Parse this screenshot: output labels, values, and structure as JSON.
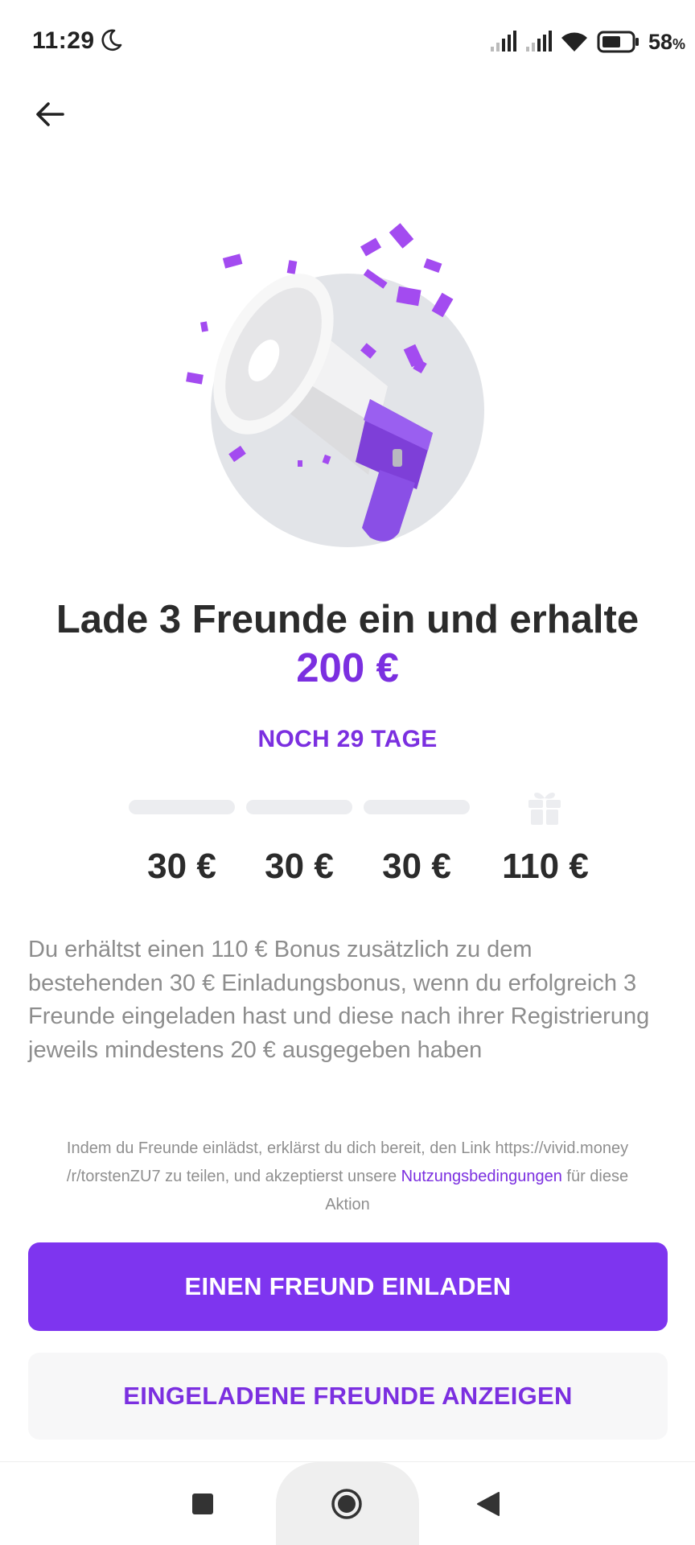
{
  "status_bar": {
    "time": "11:29",
    "battery_percent": "58",
    "battery_unit": "%",
    "icons": [
      "moon-icon",
      "signal-icon",
      "signal-icon",
      "wifi-icon",
      "battery-icon"
    ]
  },
  "header": {
    "back_icon": "arrow-left-icon"
  },
  "hero": {
    "image": "megaphone-confetti-illustration"
  },
  "main": {
    "headline": "Lade 3 Freunde ein und erhalte",
    "amount": "200 €",
    "countdown": "NOCH 29 TAGE",
    "progress": {
      "completed": 0,
      "total": 3
    },
    "rewards": [
      "30 €",
      "30 €",
      "30 €",
      "110 €"
    ],
    "description": "Du erhältst einen 110 € Bonus zusätzlich zu dem bestehenden 30 € Einladungsbonus, wenn du erfolgreich 3 Freunde eingeladen hast und diese nach ihrer Registrierung jeweils mindestens 20 € ausgegeben haben",
    "terms": {
      "before": "Indem du Freunde einlädst, erklärst du dich bereit, den Link https://vivid.money /r/torstenZU7 zu teilen, und akzeptierst unsere ",
      "link": "Nutzungsbedingungen",
      "after": " für diese Aktion"
    }
  },
  "buttons": {
    "invite": "EINEN FREUND EINLADEN",
    "show_invited": "EINGELADENE FREUNDE ANZEIGEN"
  },
  "colors": {
    "accent": "#7e35ef",
    "accent_text": "#7b2fe0",
    "muted_text": "#8d8d8d",
    "track": "#ecedf0"
  }
}
